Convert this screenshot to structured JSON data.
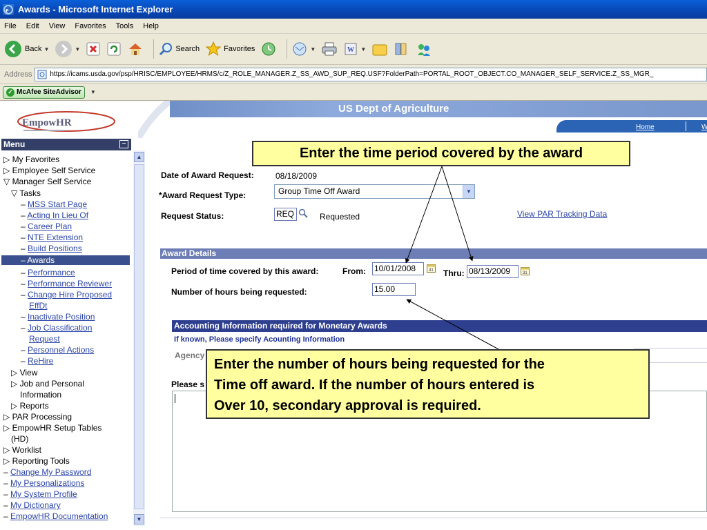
{
  "window": {
    "title": "Awards - Microsoft Internet Explorer"
  },
  "menubar": {
    "items": [
      "File",
      "Edit",
      "View",
      "Favorites",
      "Tools",
      "Help"
    ]
  },
  "toolbar": {
    "back_label": "Back",
    "search_label": "Search",
    "favorites_label": "Favorites"
  },
  "addressbar": {
    "label": "Address",
    "url": "https://icams.usda.gov/psp/HRISC/EMPLOYEE/HRMS/c/Z_ROLE_MANAGER.Z_SS_AWD_SUP_REQ.USF?FolderPath=PORTAL_ROOT_OBJECT.CO_MANAGER_SELF_SERVICE.Z_SS_MGR_"
  },
  "addon": {
    "mcafee_label": "McAfee SiteAdvisor"
  },
  "banner": {
    "logo_text": "EmpowHR",
    "org_title": "US Dept of Agriculture",
    "home_link": "Home",
    "next_link": "W"
  },
  "menu": {
    "title": "Menu",
    "items": [
      {
        "label": "My Favorites"
      },
      {
        "label": "Employee Self Service"
      },
      {
        "label": "Manager Self Service"
      },
      {
        "label": "Tasks"
      },
      {
        "label": "MSS Start Page"
      },
      {
        "label": "Acting In Lieu Of"
      },
      {
        "label": "Career Plan"
      },
      {
        "label": "NTE Extension"
      },
      {
        "label": "Build Positions"
      },
      {
        "label": "Awards"
      },
      {
        "label": "Performance"
      },
      {
        "label": "Performance Reviewer"
      },
      {
        "label": "Change Hire Proposed"
      },
      {
        "label": "EffDt"
      },
      {
        "label": "Inactivate Position"
      },
      {
        "label": "Job Classification"
      },
      {
        "label": "Request"
      },
      {
        "label": "Personnel Actions"
      },
      {
        "label": "ReHire"
      },
      {
        "label": "View"
      },
      {
        "label": "Job and Personal"
      },
      {
        "label": "Information"
      },
      {
        "label": "Reports"
      },
      {
        "label": "PAR Processing"
      },
      {
        "label": "EmpowHR Setup Tables"
      },
      {
        "label": "(HD)"
      },
      {
        "label": "Worklist"
      },
      {
        "label": "Reporting Tools"
      },
      {
        "label": "Change My Password"
      },
      {
        "label": "My Personalizations"
      },
      {
        "label": "My System Profile"
      },
      {
        "label": "My Dictionary"
      },
      {
        "label": "EmpowHR Documentation"
      }
    ]
  },
  "form": {
    "date_label": "Date of Award Request:",
    "date_value": "08/18/2009",
    "type_label": "*Award Request Type:",
    "type_value": "Group Time Off Award",
    "status_label": "Request Status:",
    "status_code": "REQ",
    "status_text": "Requested",
    "par_link": "View PAR Tracking Data",
    "details_header": "Award Details",
    "period_label": "Period of time covered by this award:",
    "from_label": "From:",
    "from_value": "10/01/2008",
    "thru_label": "Thru:",
    "thru_value": "08/13/2009",
    "hours_label": "Number of hours being requested:",
    "hours_value": "15.00",
    "acct_header": "Accounting Information required for Monetary Awards",
    "acct_sub": "If known, Please specify Acounting Information",
    "agency_label": "Agency",
    "please_label": "Please s"
  },
  "callouts": {
    "period": "Enter the time period covered by the award",
    "hours": "Enter the number of hours  being requested for the\nTime off award.  If the number of hours entered is\nOver 10, secondary approval is required."
  },
  "colors": {
    "callout_bg": "#ffff9f",
    "menu_header": "#333f66",
    "section_header": "#6d7db5",
    "acct_header": "#2e3f8f",
    "link": "#2c45a8"
  }
}
